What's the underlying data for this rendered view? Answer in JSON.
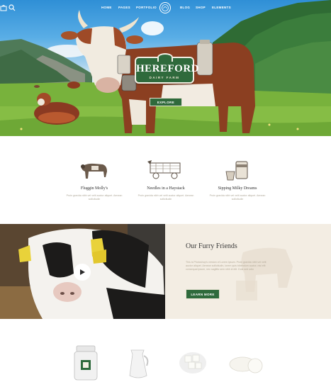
{
  "nav": {
    "items": [
      "HOME",
      "PAGES",
      "PORTFOLIO",
      "BLOG",
      "SHOP",
      "ELEMENTS"
    ]
  },
  "hero": {
    "brand_name": "HEREFORD",
    "brand_sub": "DAIRY FARM",
    "explore_label": "EXPLORE"
  },
  "features": [
    {
      "title": "Fluggin Molly's",
      "desc": "Proin gravida nibh vel velit auctor aliquet. Aenean sollicitudin",
      "icon": "cow-sketch-icon"
    },
    {
      "title": "Needles in a Haystack",
      "desc": "Proin gravida nibh vel velit auctor aliquet. Aenean sollicitudin",
      "icon": "hay-wagon-icon"
    },
    {
      "title": "Sipping Milky Dreams",
      "desc": "Proin gravida nibh vel velit auctor aliquet. Aenean sollicitudin",
      "icon": "milk-bucket-icon"
    }
  ],
  "about": {
    "title": "Our Furry Friends",
    "text": "This is Photoshop's version of Lorem Ipsum. Proin gravida nibh vel velit auctor aliquet. Aenean sollicitudin, lorem quis bibendum auctor, nisi elit consequat ipsum, nec sagittis sem nibh id elit. Duis sed odio",
    "button_label": "LEARN MORE"
  },
  "colors": {
    "accent_green": "#2f6a3c",
    "cream": "#f3ede3"
  }
}
